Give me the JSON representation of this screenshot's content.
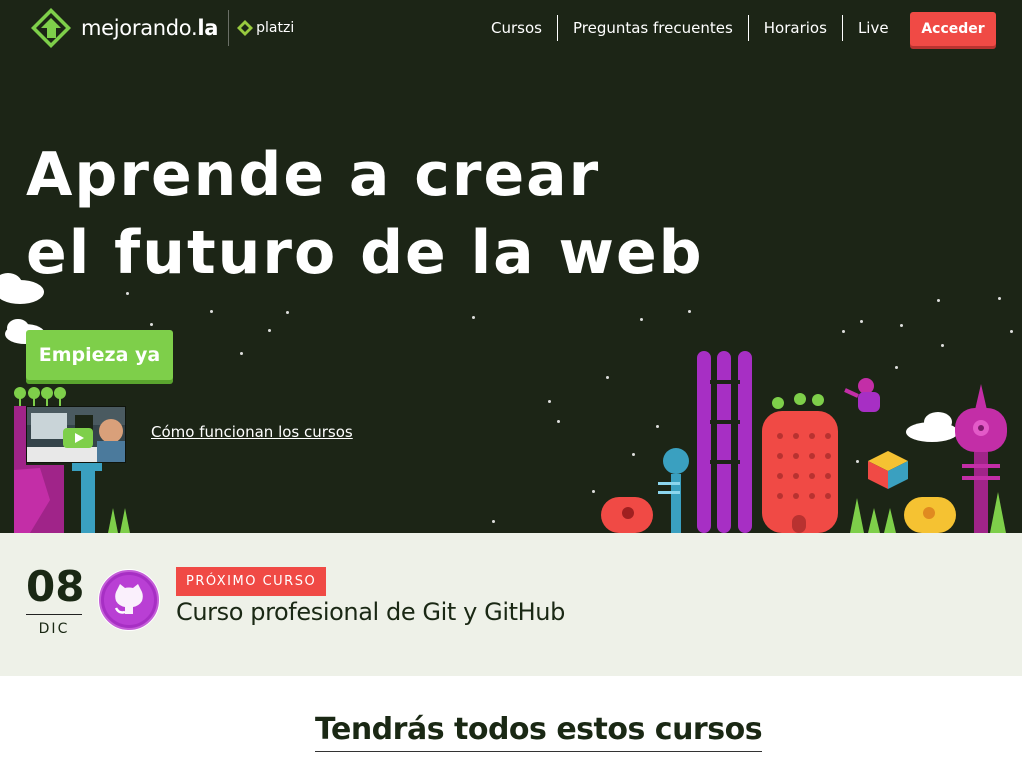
{
  "brand": {
    "name_light": "mejorando.",
    "name_bold": "la",
    "partner": "platzi"
  },
  "nav": {
    "items": [
      "Cursos",
      "Preguntas frecuentes",
      "Horarios",
      "Live"
    ],
    "login_label": "Acceder"
  },
  "hero": {
    "headline_line1": "Aprende a crear",
    "headline_line2": "el futuro de la web",
    "cta_label": "Empieza ya",
    "video_link_label": "Cómo funcionan los cursos"
  },
  "next_course": {
    "day": "08",
    "month": "DIC",
    "badge": "PRÓXIMO CURSO",
    "title": "Curso profesional de Git y GitHub"
  },
  "courses_section": {
    "title": "Tendrás todos estos cursos"
  },
  "colors": {
    "hero_bg": "#1c2516",
    "accent_red": "#f04a45",
    "accent_green": "#7ecf4a",
    "next_bg": "#eef1e8",
    "github_purple": "#a72fc4"
  },
  "icons": [
    "logo-icon",
    "platzi-icon",
    "play-icon",
    "github-icon"
  ]
}
